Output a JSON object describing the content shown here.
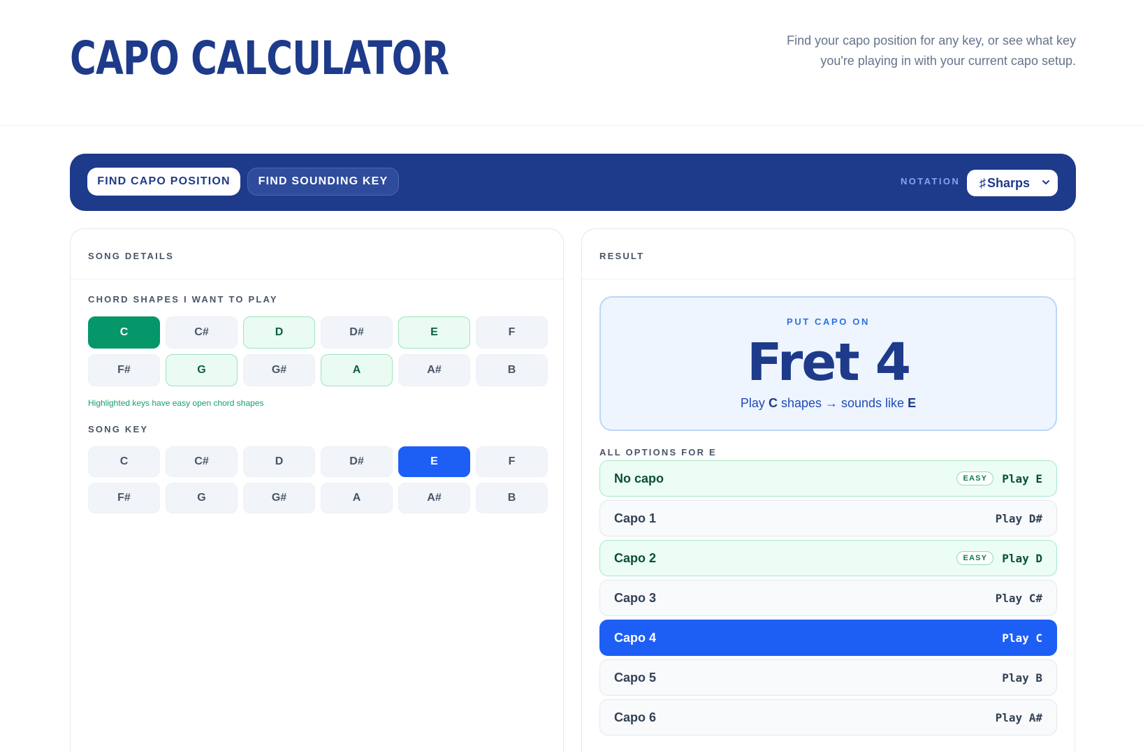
{
  "header": {
    "title": "Capo Calculator",
    "tagline": "Find your capo position for any key, or see what key you're playing in with your current capo setup."
  },
  "toolbar": {
    "mode_active": "FIND CAPO POSITION",
    "mode_other": "FIND SOUNDING KEY",
    "notation_label": "NOTATION",
    "notation_icon": "sharp-icon",
    "notation_symbol": "♯",
    "notation_value": "Sharps"
  },
  "left_panel": {
    "heading": "SONG DETAILS",
    "chord_shapes_label": "CHORD SHAPES I WANT TO PLAY",
    "chord_shapes": [
      "C",
      "C#",
      "D",
      "D#",
      "E",
      "F",
      "F#",
      "G",
      "G#",
      "A",
      "A#",
      "B"
    ],
    "chord_shapes_selected": "C",
    "easy_keys": [
      "C",
      "D",
      "E",
      "G",
      "A"
    ],
    "hint": "Highlighted keys have easy open chord shapes",
    "song_key_label": "SONG KEY",
    "song_keys": [
      "C",
      "C#",
      "D",
      "D#",
      "E",
      "F",
      "F#",
      "G",
      "G#",
      "A",
      "A#",
      "B"
    ],
    "song_key_selected": "E"
  },
  "right_panel": {
    "heading": "RESULT",
    "result": {
      "kicker": "PUT CAPO ON",
      "main": "Fret 4",
      "sub_prefix": "Play",
      "sub_shape": "C",
      "sub_middle": "shapes → sounds like",
      "sub_key": "E"
    },
    "options_label": "ALL OPTIONS FOR E",
    "easy_badge": "EASY",
    "options": [
      {
        "name": "No capo",
        "play": "Play E",
        "easy": true,
        "selected": false
      },
      {
        "name": "Capo 1",
        "play": "Play D#",
        "easy": false,
        "selected": false
      },
      {
        "name": "Capo 2",
        "play": "Play D",
        "easy": true,
        "selected": false
      },
      {
        "name": "Capo 3",
        "play": "Play C#",
        "easy": false,
        "selected": false
      },
      {
        "name": "Capo 4",
        "play": "Play C",
        "easy": false,
        "selected": true
      },
      {
        "name": "Capo 5",
        "play": "Play B",
        "easy": false,
        "selected": false
      },
      {
        "name": "Capo 6",
        "play": "Play A#",
        "easy": false,
        "selected": false
      }
    ]
  },
  "colors": {
    "brand": "#1e3a8a",
    "accent_blue": "#1d5ef5",
    "easy_green": "#059669"
  }
}
